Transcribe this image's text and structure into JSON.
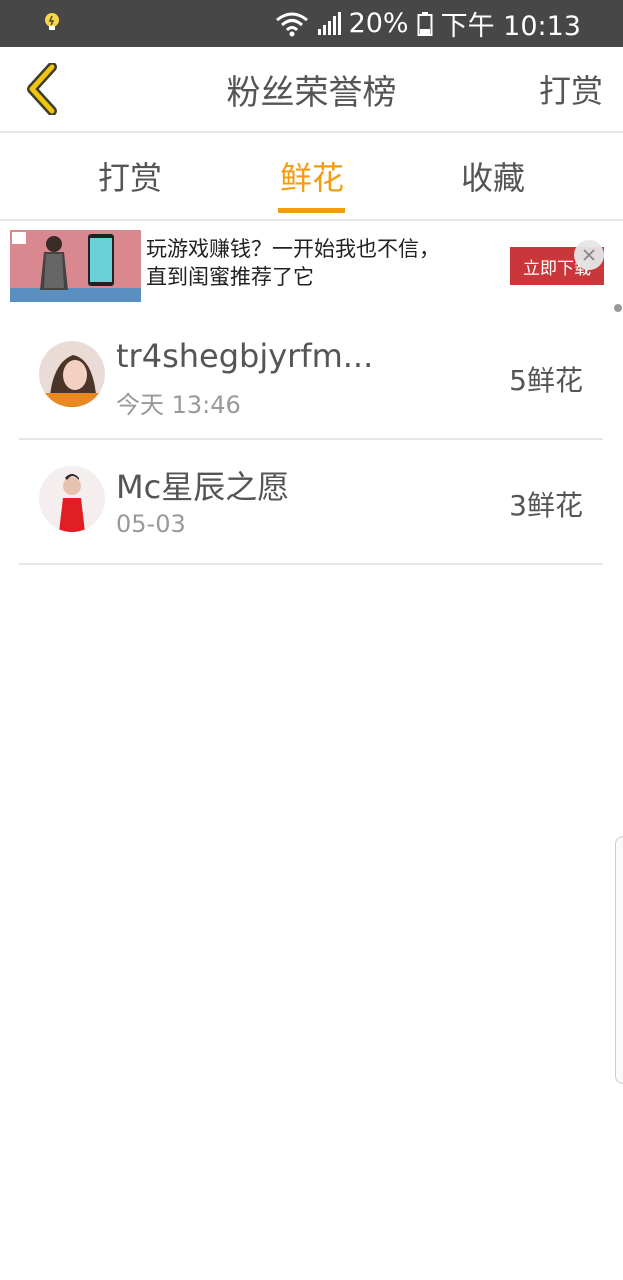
{
  "status_bar": {
    "battery": "20%",
    "time": "下午 10:13",
    "icons": [
      "notification-bulb-icon",
      "wifi-icon",
      "signal-icon",
      "battery-icon"
    ]
  },
  "header": {
    "title": "粉丝荣誉榜",
    "action": "打赏",
    "back_icon": "chevron-left-icon"
  },
  "tabs": [
    {
      "label": "打赏",
      "active": false
    },
    {
      "label": "鲜花",
      "active": true
    },
    {
      "label": "收藏",
      "active": false
    }
  ],
  "ad": {
    "line1": "玩游戏赚钱？一开始我也不信，",
    "line2": "直到闺蜜推荐了它",
    "button": "立即下载"
  },
  "list": [
    {
      "name": "tr4shegbjyrfm...",
      "time": "今天 13:46",
      "count": "5鲜花"
    },
    {
      "name": "Mc星辰之愿",
      "time": "05-03",
      "count": "3鲜花"
    }
  ],
  "colors": {
    "accent": "#f39c12",
    "status_bar_bg": "#474747",
    "back_icon": "#f1c40f",
    "ad_button": "#c9373a"
  }
}
